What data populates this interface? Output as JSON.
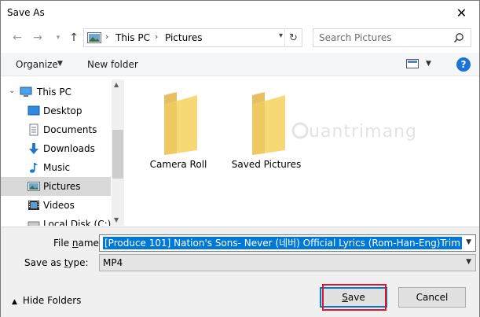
{
  "window": {
    "title": "Save As"
  },
  "nav": {
    "back_icon": "arrow-left-icon",
    "forward_icon": "arrow-right-icon",
    "recent_icon": "chevron-down-icon",
    "up_icon": "arrow-up-icon"
  },
  "address": {
    "segments": [
      "This PC",
      "Pictures"
    ]
  },
  "search": {
    "placeholder": "Search Pictures"
  },
  "commandbar": {
    "organize": "Organize",
    "new_folder": "New folder"
  },
  "sidebar": {
    "items": [
      {
        "label": "This PC",
        "icon": "computer-icon"
      },
      {
        "label": "Desktop",
        "icon": "desktop-icon"
      },
      {
        "label": "Documents",
        "icon": "documents-icon"
      },
      {
        "label": "Downloads",
        "icon": "download-icon"
      },
      {
        "label": "Music",
        "icon": "music-icon"
      },
      {
        "label": "Pictures",
        "icon": "pictures-icon",
        "selected": true
      },
      {
        "label": "Videos",
        "icon": "videos-icon"
      },
      {
        "label": "Local Disk (C:)",
        "icon": "disk-icon"
      }
    ]
  },
  "content": {
    "folders": [
      {
        "label": "Camera Roll"
      },
      {
        "label": "Saved Pictures"
      }
    ]
  },
  "watermark": {
    "text": "uantrimang"
  },
  "form": {
    "filename_label_prefix": "File ",
    "filename_label_access": "n",
    "filename_label_suffix": "ame:",
    "filename_value": "[Produce 101] Nation's Sons- Never (네버) Official Lyrics (Rom-Han-Eng)Trim",
    "type_label_prefix": "Save as ",
    "type_label_access": "t",
    "type_label_suffix": "ype:",
    "type_value": "MP4"
  },
  "footer": {
    "hide_folders": "Hide Folders",
    "save_access": "S",
    "save_rest": "ave",
    "cancel": "Cancel"
  },
  "colors": {
    "accent": "#0078d7",
    "highlight": "#e0142b",
    "folder": "#f8d775"
  }
}
